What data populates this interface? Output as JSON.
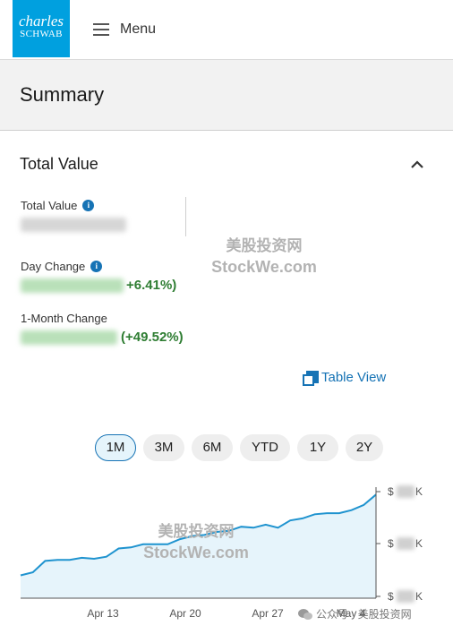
{
  "header": {
    "logo_line1": "charles",
    "logo_line2": "SCHWAB",
    "menu_label": "Menu",
    "logo_color": "#00a0df"
  },
  "summary": {
    "title": "Summary"
  },
  "total_value_section": {
    "title": "Total Value",
    "total_value_label": "Total Value",
    "day_change_label": "Day Change",
    "day_change_pct": "+6.41%)",
    "month_change_label": "1-Month Change",
    "month_change_pct": "(+49.52%)",
    "info_icon": "info-icon",
    "positive_color": "#2e7d32"
  },
  "watermarks": {
    "cn": "美股投资网",
    "en": "StockWe.com",
    "footer": "公众号 · 美股投资网"
  },
  "table_view_label": "Table View",
  "range_buttons": [
    {
      "label": "1M",
      "active": true
    },
    {
      "label": "3M",
      "active": false
    },
    {
      "label": "6M",
      "active": false
    },
    {
      "label": "YTD",
      "active": false
    },
    {
      "label": "1Y",
      "active": false
    },
    {
      "label": "2Y",
      "active": false
    }
  ],
  "chart_data": {
    "type": "area",
    "x_tick_labels": [
      "Apr 13",
      "Apr 20",
      "Apr 27",
      "May 4"
    ],
    "y_tick_labels": [
      "$ K",
      "$ K",
      "$ K"
    ],
    "y_tick_symbols": {
      "currency": "$",
      "suffix": "K"
    },
    "values": [
      0.22,
      0.25,
      0.36,
      0.37,
      0.37,
      0.39,
      0.38,
      0.4,
      0.48,
      0.49,
      0.52,
      0.52,
      0.52,
      0.57,
      0.6,
      0.61,
      0.64,
      0.65,
      0.69,
      0.68,
      0.71,
      0.68,
      0.75,
      0.77,
      0.81,
      0.82,
      0.82,
      0.85,
      0.9,
      1.0
    ],
    "ylim": [
      0,
      1.02
    ],
    "line_color": "#1f93cf",
    "fill_color": "#e6f4fb",
    "grid": false
  }
}
